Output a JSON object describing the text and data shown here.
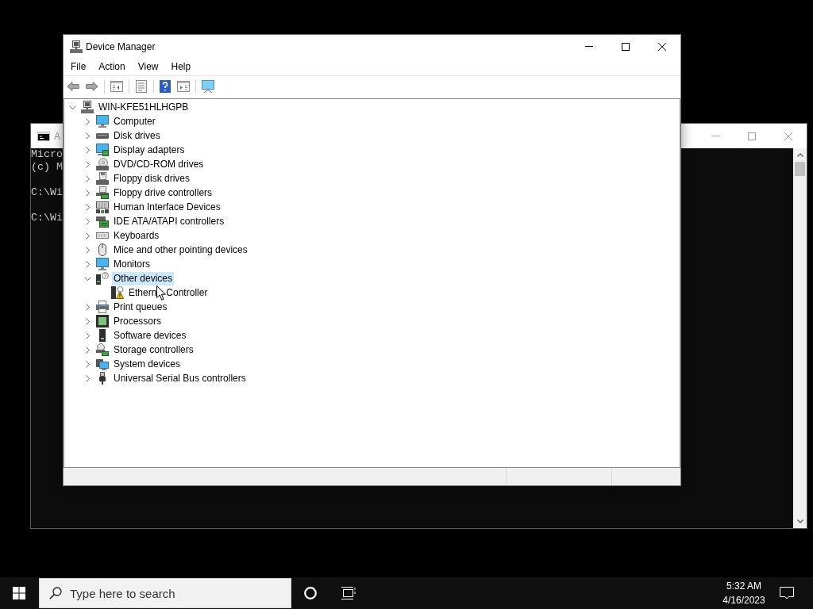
{
  "console_window": {
    "title": "A",
    "output": [
      [
        "Micro",
        "(c) M"
      ],
      [
        "C:\\Wi"
      ],
      [
        "C:\\Wi"
      ]
    ]
  },
  "device_manager": {
    "title": "Device Manager",
    "menu": [
      "File",
      "Action",
      "View",
      "Help"
    ],
    "tree": {
      "label": "WIN-KFE51HLHGPB",
      "expanded": true,
      "selected": false,
      "children": [
        {
          "label": "Computer",
          "expanded": false,
          "selected": false
        },
        {
          "label": "Disk drives",
          "expanded": false,
          "selected": false
        },
        {
          "label": "Display adapters",
          "expanded": false,
          "selected": false
        },
        {
          "label": "DVD/CD-ROM drives",
          "expanded": false,
          "selected": false
        },
        {
          "label": "Floppy disk drives",
          "expanded": false,
          "selected": false
        },
        {
          "label": "Floppy drive controllers",
          "expanded": false,
          "selected": false
        },
        {
          "label": "Human Interface Devices",
          "expanded": false,
          "selected": false
        },
        {
          "label": "IDE ATA/ATAPI controllers",
          "expanded": false,
          "selected": false
        },
        {
          "label": "Keyboards",
          "expanded": false,
          "selected": false
        },
        {
          "label": "Mice and other pointing devices",
          "expanded": false,
          "selected": false
        },
        {
          "label": "Monitors",
          "expanded": false,
          "selected": false
        },
        {
          "label": "Other devices",
          "expanded": true,
          "selected": true,
          "children": [
            {
              "label_parts": [
                "Ethern",
                "Controller"
              ],
              "selected": false
            }
          ]
        },
        {
          "label": "Print queues",
          "expanded": false,
          "selected": false
        },
        {
          "label": "Processors",
          "expanded": false,
          "selected": false
        },
        {
          "label": "Software devices",
          "expanded": false,
          "selected": false
        },
        {
          "label": "Storage controllers",
          "expanded": false,
          "selected": false
        },
        {
          "label": "System devices",
          "expanded": false,
          "selected": false
        },
        {
          "label": "Universal Serial Bus controllers",
          "expanded": false,
          "selected": false
        }
      ]
    }
  },
  "taskbar": {
    "search": {
      "placeholder": "Type here to search"
    },
    "clock": {
      "time": "5:32 AM",
      "date": "4/16/2023"
    }
  }
}
